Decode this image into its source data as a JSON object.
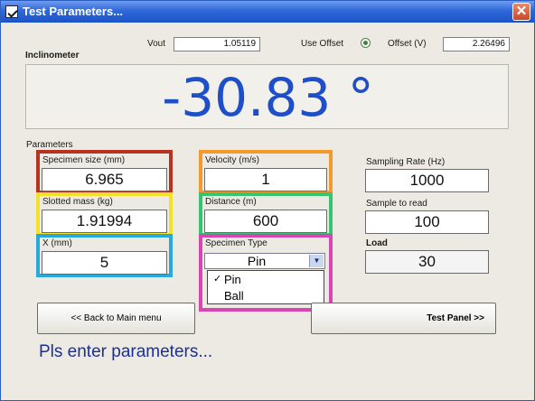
{
  "window": {
    "title": "Test Parameters...",
    "close_label": "✕"
  },
  "header": {
    "vout_label": "Vout",
    "vout_value": "1.05119",
    "use_offset_label": "Use Offset",
    "offset_label": "Offset (V)",
    "offset_value": "2.26496"
  },
  "inclinometer": {
    "label": "Inclinometer",
    "reading": "-30.83 °"
  },
  "parameters": {
    "group_label": "Parameters",
    "specimen_size": {
      "label": "Specimen size (mm)",
      "value": "6.965"
    },
    "slotted_mass": {
      "label": "Slotted mass (kg)",
      "value": "1.91994"
    },
    "x": {
      "label": "X (mm)",
      "value": "5"
    },
    "velocity": {
      "label": "Velocity (m/s)",
      "value": "1"
    },
    "distance": {
      "label": "Distance (m)",
      "value": "600"
    },
    "specimen_type": {
      "label": "Specimen Type",
      "selected": "Pin",
      "options": [
        "Pin",
        "Ball"
      ],
      "check": "✓"
    },
    "sampling_rate": {
      "label": "Sampling Rate (Hz)",
      "value": "1000"
    },
    "sample_to_read": {
      "label": "Sample to read",
      "value": "100"
    },
    "load": {
      "label": "Load",
      "value": "30"
    }
  },
  "buttons": {
    "back": "<< Back to Main menu",
    "test_panel": "Test Panel >>"
  },
  "status": "Pls enter parameters...",
  "highlight_colors": {
    "specimen_size": "#b5331f",
    "slotted_mass": "#f2e32a",
    "x": "#29a8dc",
    "velocity": "#f39a2e",
    "distance": "#35c470",
    "specimen_type": "#d846b4"
  }
}
